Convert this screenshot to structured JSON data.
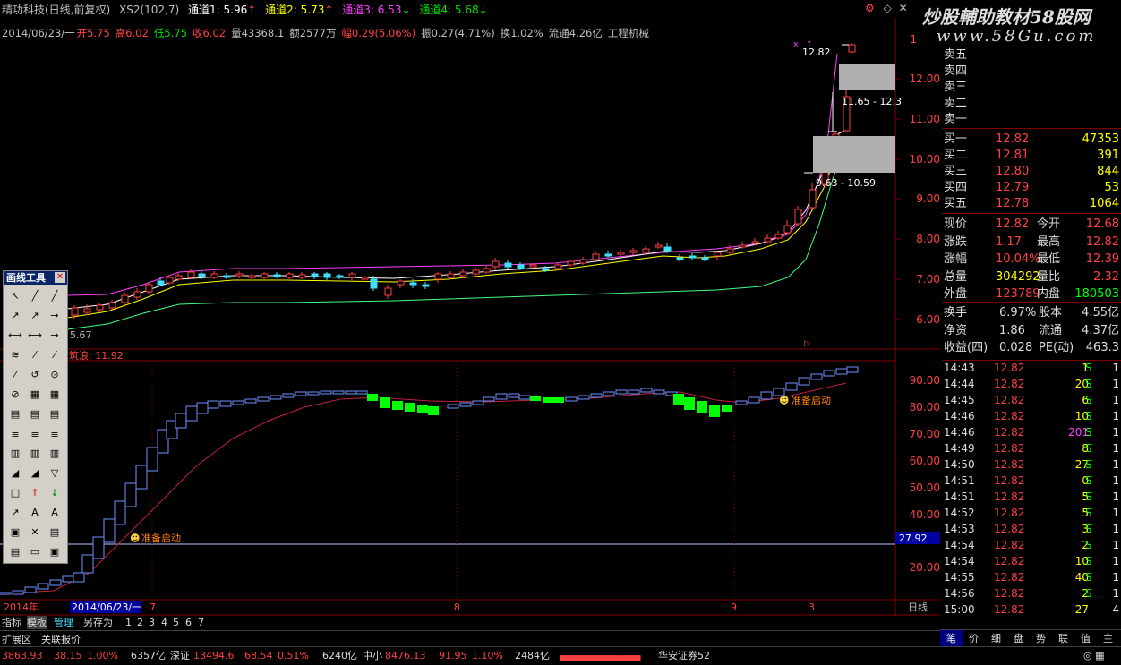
{
  "watermark": "炒股輔助教材58股网",
  "watermark_url": "www.58Gu.com",
  "header": {
    "stock": "精功科技(日线,前复权)",
    "indicator": "XS2(102,7)",
    "ch1": "通道1: 5.96",
    "ch2": "通道2: 5.73",
    "ch3": "通道3: 6.53",
    "ch4": "通道4: 5.68"
  },
  "info": {
    "date": "2014/06/23/一",
    "open": "开5.75",
    "high": "高6.02",
    "low": "低5.75",
    "close": "收6.02",
    "vol": "量43368.1",
    "amount": "额2577万",
    "change": "幅0.29(5.06%)",
    "amp": "振0.27(4.71%)",
    "turnover": "换1.02%",
    "float": "流通4.26亿",
    "industry": "工程机械"
  },
  "main_chart": {
    "y_ticks": [
      "12.00",
      "11.00",
      "10.00",
      "9.00",
      "8.00",
      "7.00",
      "6.00"
    ],
    "top_tick": "1",
    "annot_high": "12.82",
    "annot_box1": "11.65 - 12.3",
    "annot_box2": "9.63 - 10.59",
    "low_label": "5.67"
  },
  "sub_chart": {
    "title": "筑浪: 11.92",
    "y_ticks": [
      "90.00",
      "80.00",
      "70.00",
      "60.00",
      "50.00",
      "40.00",
      "20.00"
    ],
    "level_label": "27.92",
    "signal1": "准备启动",
    "signal2": "准备启动"
  },
  "x_axis": {
    "year": "2014年",
    "cursor_date": "2014/06/23/一",
    "m7": "7",
    "m8": "8",
    "m9": "9",
    "m3": "3",
    "period": "日线"
  },
  "toolbox": {
    "title": "画线工具"
  },
  "bottom_tabs": [
    "指标",
    "模板",
    "管理",
    "另存为",
    "1",
    "2",
    "3",
    "4",
    "5",
    "6",
    "7"
  ],
  "ext_tabs": [
    "扩展区",
    "关联报价"
  ],
  "quote": {
    "sells": [
      {
        "label": "卖五",
        "price": "",
        "vol": ""
      },
      {
        "label": "卖四",
        "price": "",
        "vol": ""
      },
      {
        "label": "卖三",
        "price": "",
        "vol": ""
      },
      {
        "label": "卖二",
        "price": "",
        "vol": ""
      },
      {
        "label": "卖一",
        "price": "",
        "vol": ""
      }
    ],
    "buys": [
      {
        "label": "买一",
        "price": "12.82",
        "vol": "47353"
      },
      {
        "label": "买二",
        "price": "12.81",
        "vol": "391"
      },
      {
        "label": "买三",
        "price": "12.80",
        "vol": "844"
      },
      {
        "label": "买四",
        "price": "12.79",
        "vol": "53"
      },
      {
        "label": "买五",
        "price": "12.78",
        "vol": "1064"
      }
    ],
    "stats": [
      {
        "l1": "现价",
        "v1": "12.82",
        "l2": "今开",
        "v2": "12.68"
      },
      {
        "l1": "涨跌",
        "v1": "1.17",
        "l2": "最高",
        "v2": "12.82"
      },
      {
        "l1": "涨幅",
        "v1": "10.04%",
        "l2": "最低",
        "v2": "12.39"
      },
      {
        "l1": "总量",
        "v1": "304292",
        "l2": "量比",
        "v2": "2.32"
      },
      {
        "l1": "外盘",
        "v1": "123789",
        "l2": "内盘",
        "v2": "180503"
      }
    ],
    "stats2": [
      {
        "l1": "换手",
        "v1": "6.97%",
        "l2": "股本",
        "v2": "4.55亿"
      },
      {
        "l1": "净资",
        "v1": "1.86",
        "l2": "流通",
        "v2": "4.37亿"
      },
      {
        "l1": "收益(四)",
        "v1": "0.028",
        "l2": "PE(动)",
        "v2": "463.3"
      }
    ]
  },
  "ticks": [
    {
      "t": "14:43",
      "p": "12.82",
      "v": "1",
      "s": "S",
      "n": "1"
    },
    {
      "t": "14:44",
      "p": "12.82",
      "v": "20",
      "s": "S",
      "n": "1"
    },
    {
      "t": "14:45",
      "p": "12.82",
      "v": "6",
      "s": "S",
      "n": "1"
    },
    {
      "t": "14:46",
      "p": "12.82",
      "v": "10",
      "s": "S",
      "n": "1"
    },
    {
      "t": "14:46",
      "p": "12.82",
      "v": "201",
      "s": "S",
      "n": "1"
    },
    {
      "t": "14:49",
      "p": "12.82",
      "v": "8",
      "s": "S",
      "n": "1"
    },
    {
      "t": "14:50",
      "p": "12.82",
      "v": "27",
      "s": "S",
      "n": "1"
    },
    {
      "t": "14:51",
      "p": "12.82",
      "v": "0",
      "s": "S",
      "n": "1"
    },
    {
      "t": "14:51",
      "p": "12.82",
      "v": "5",
      "s": "S",
      "n": "1"
    },
    {
      "t": "14:52",
      "p": "12.82",
      "v": "5",
      "s": "S",
      "n": "1"
    },
    {
      "t": "14:53",
      "p": "12.82",
      "v": "3",
      "s": "S",
      "n": "1"
    },
    {
      "t": "14:54",
      "p": "12.82",
      "v": "2",
      "s": "S",
      "n": "1"
    },
    {
      "t": "14:54",
      "p": "12.82",
      "v": "10",
      "s": "S",
      "n": "1"
    },
    {
      "t": "14:55",
      "p": "12.82",
      "v": "40",
      "s": "S",
      "n": "1"
    },
    {
      "t": "14:56",
      "p": "12.82",
      "v": "2",
      "s": "S",
      "n": "1"
    },
    {
      "t": "15:00",
      "p": "12.82",
      "v": "27",
      "s": "",
      "n": "4"
    }
  ],
  "right_tabs": [
    "笔",
    "价",
    "细",
    "盘",
    "势",
    "联",
    "值",
    "主"
  ],
  "status": {
    "sh_idx": "3863.93",
    "sh_chg": "38.15",
    "sh_pct": "1.00%",
    "sh_amt": "6357亿",
    "sz_label": "深证",
    "sz_idx": "13494.6",
    "sz_chg": "68.54",
    "sz_pct": "0.51%",
    "sz_amt": "6240亿",
    "zx_label": "中小",
    "zx_idx": "8476.13",
    "zx_chg": "91.95",
    "zx_pct": "1.10%",
    "zx_amt": "2484亿",
    "broker": "华安证券52"
  }
}
